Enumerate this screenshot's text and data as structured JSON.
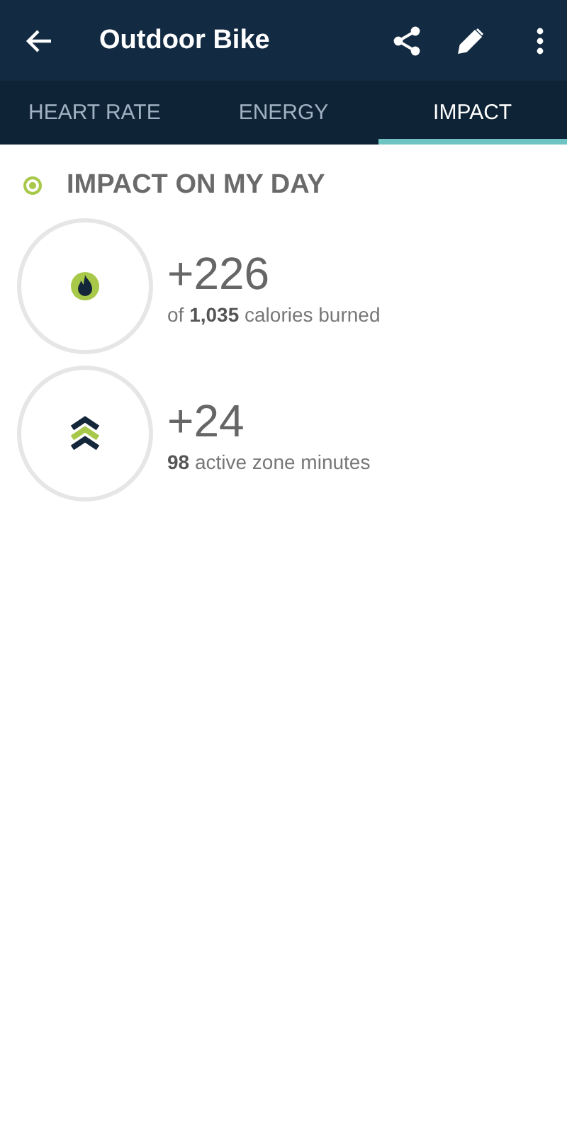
{
  "toolbar": {
    "title": "Outdoor Bike"
  },
  "tabs": [
    {
      "label": "HEART RATE",
      "selected": false
    },
    {
      "label": "ENERGY",
      "selected": false
    },
    {
      "label": "IMPACT",
      "selected": true
    }
  ],
  "section": {
    "title": "IMPACT ON MY DAY"
  },
  "stats": [
    {
      "kind": "calories",
      "value": "+226",
      "detail": "of **1,035** calories burned"
    },
    {
      "kind": "zone",
      "value": "+24",
      "detail": "**98** active zone minutes"
    }
  ]
}
